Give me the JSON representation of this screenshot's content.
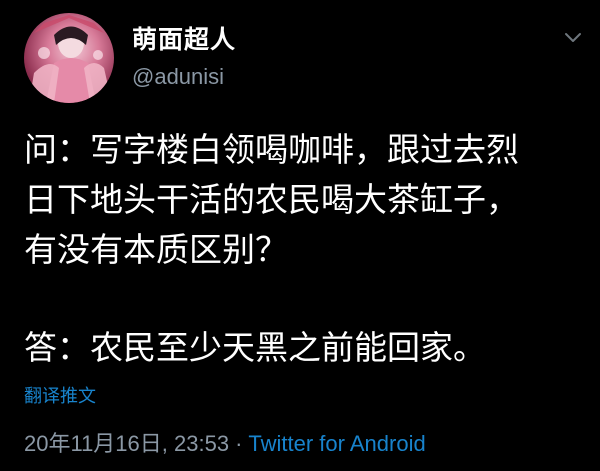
{
  "author": {
    "display_name": "萌面超人",
    "handle": "@adunisi"
  },
  "tweet": {
    "lines": [
      "问：写字楼白领喝咖啡，跟过去烈",
      "日下地头干活的农民喝大茶缸子，",
      "有没有本质区别？",
      "答：农民至少天黑之前能回家。"
    ],
    "translate_label": "翻译推文",
    "date": "20年11月16日, 23:53",
    "separator": "·",
    "source": "Twitter for Android"
  },
  "icons": {
    "more": "chevron-down-icon",
    "avatar": "avatar-image"
  },
  "colors": {
    "background": "#000000",
    "text": "#ffffff",
    "secondary": "#8b98a5",
    "link": "#1d9bf0"
  }
}
